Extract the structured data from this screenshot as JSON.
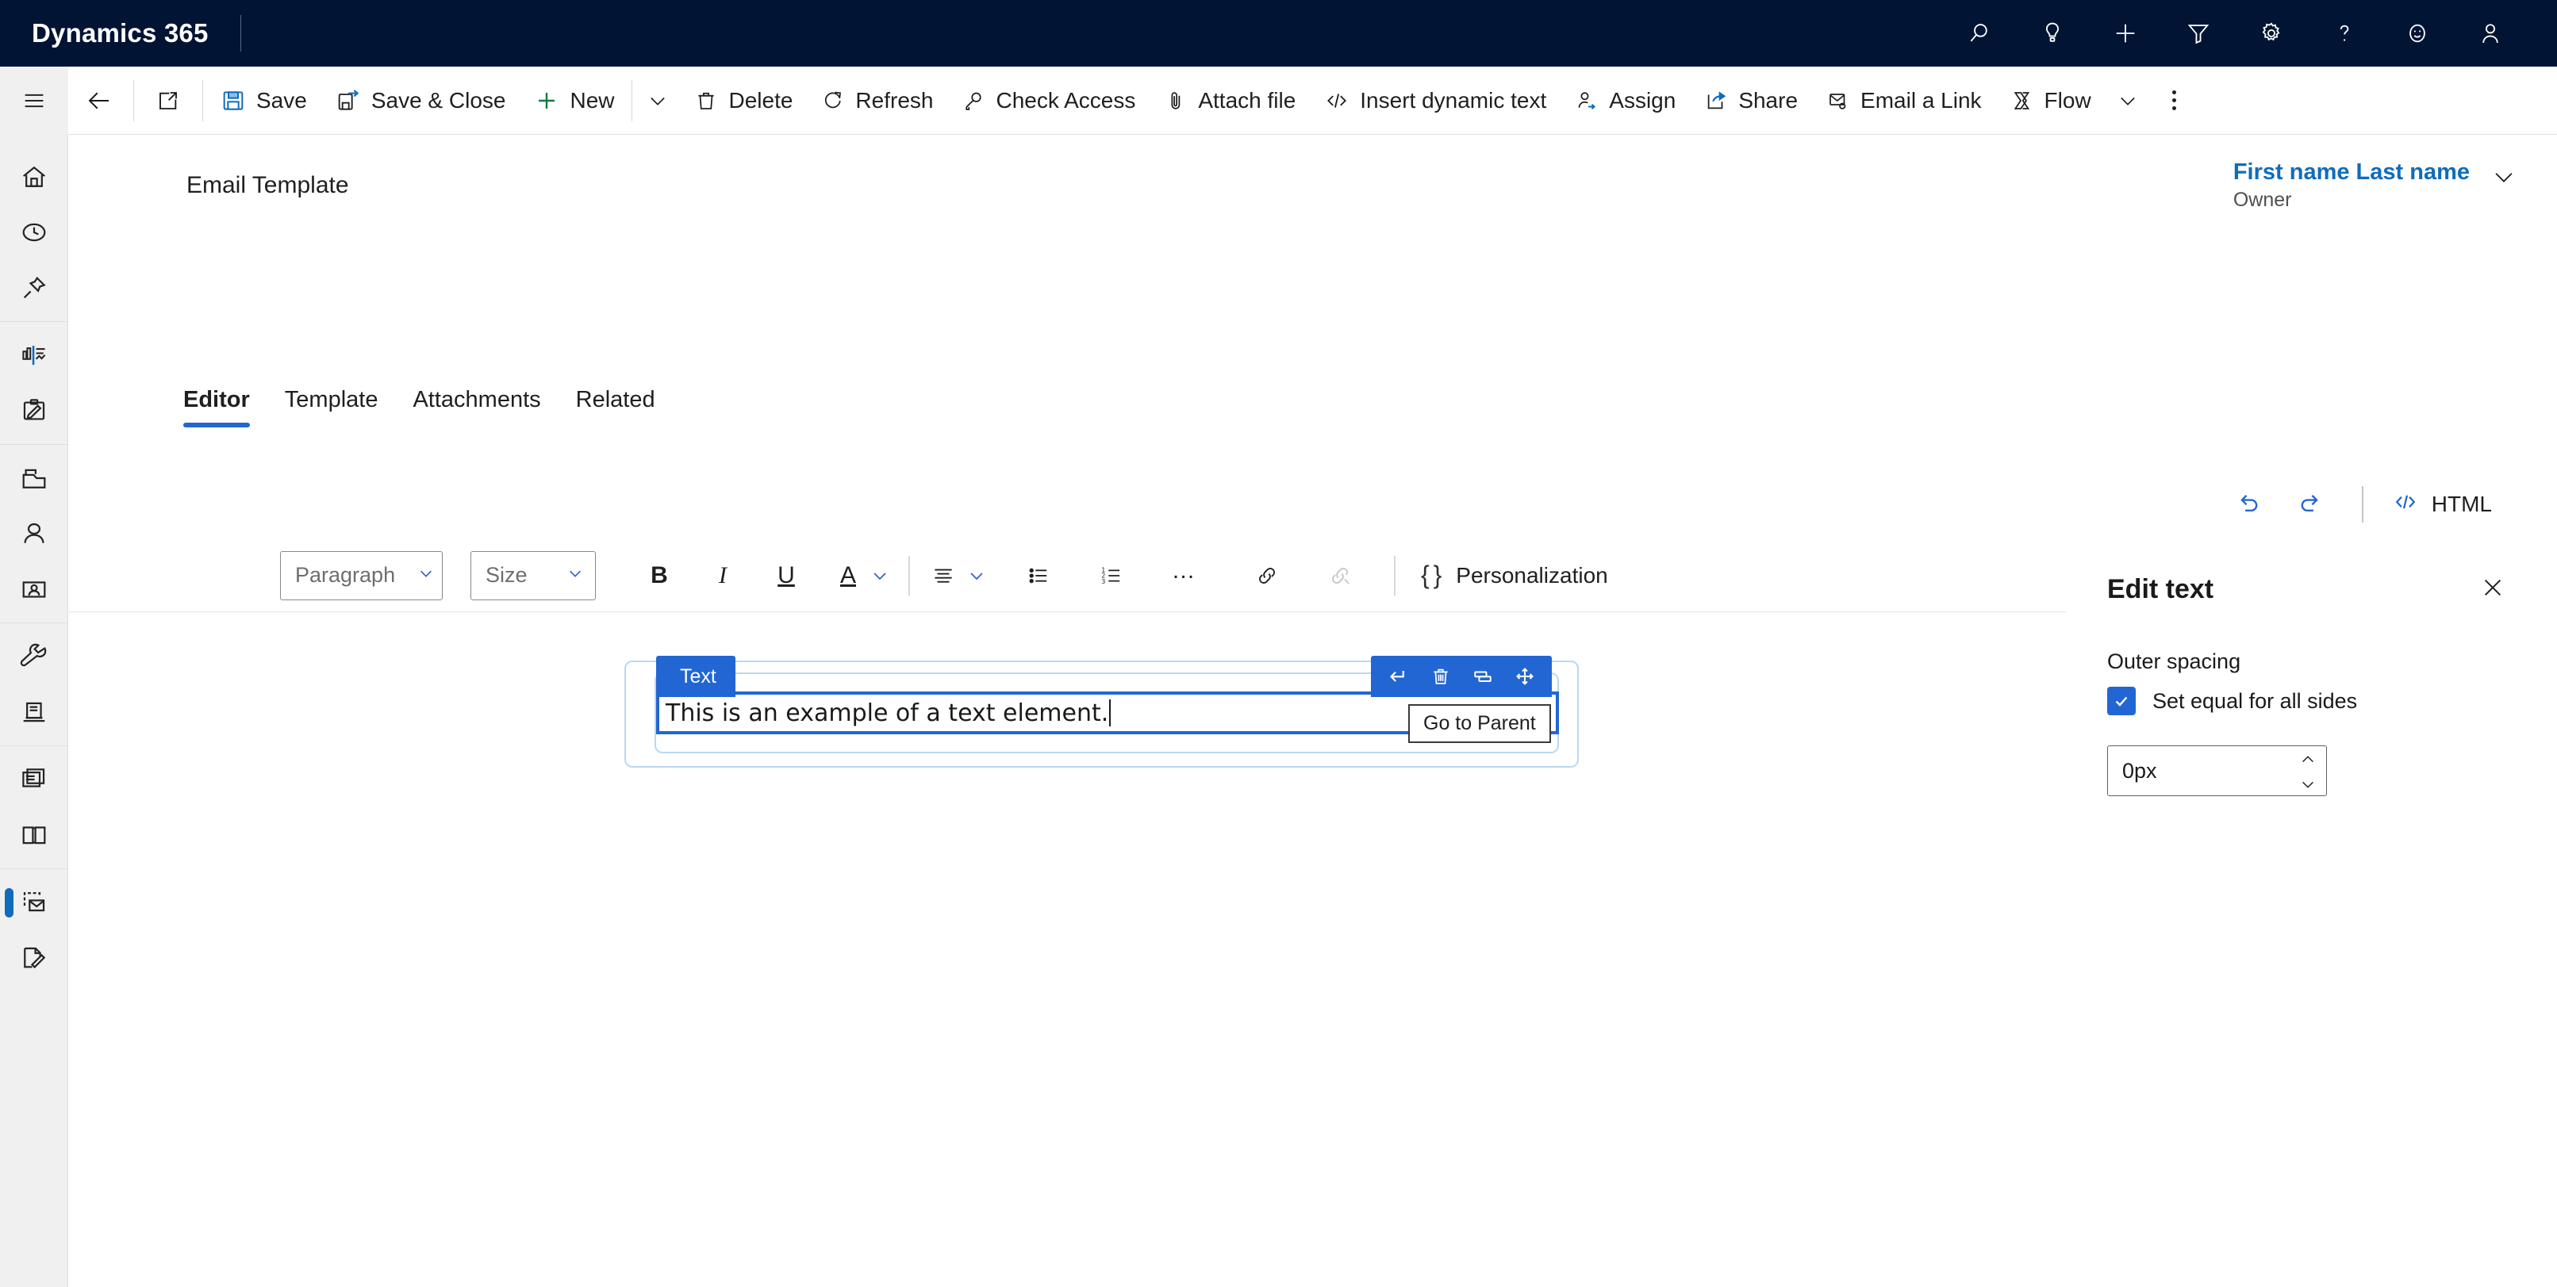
{
  "topbar": {
    "brand": "Dynamics 365",
    "icons": [
      {
        "name": "search-icon",
        "label": "Search"
      },
      {
        "name": "lightbulb-icon",
        "label": "Insights"
      },
      {
        "name": "plus-icon",
        "label": "Quick create"
      },
      {
        "name": "filter-icon",
        "label": "Filter"
      },
      {
        "name": "gear-icon",
        "label": "Settings"
      },
      {
        "name": "question-icon",
        "label": "Help"
      },
      {
        "name": "smiley-icon",
        "label": "Feedback"
      },
      {
        "name": "user-avatar-icon",
        "label": "Account"
      }
    ]
  },
  "commandbar": {
    "back_label": "Back",
    "popout_label": "Open in new window",
    "items": [
      {
        "name": "save-button",
        "label": "Save",
        "icon": "save-icon"
      },
      {
        "name": "save-and-close-button",
        "label": "Save & Close",
        "icon": "save-close-icon"
      },
      {
        "name": "new-button",
        "label": "New",
        "icon": "plus-icon"
      },
      {
        "name": "delete-button",
        "label": "Delete",
        "icon": "trash-icon"
      },
      {
        "name": "refresh-button",
        "label": "Refresh",
        "icon": "refresh-icon"
      },
      {
        "name": "check-access-button",
        "label": "Check Access",
        "icon": "key-icon"
      },
      {
        "name": "attach-file-button",
        "label": "Attach file",
        "icon": "paperclip-icon"
      },
      {
        "name": "insert-dynamic-text-button",
        "label": "Insert dynamic text",
        "icon": "code-icon"
      },
      {
        "name": "assign-button",
        "label": "Assign",
        "icon": "person-arrow-icon"
      },
      {
        "name": "share-button",
        "label": "Share",
        "icon": "share-icon"
      },
      {
        "name": "email-a-link-button",
        "label": "Email a Link",
        "icon": "envelope-link-icon"
      },
      {
        "name": "flow-button",
        "label": "Flow",
        "icon": "flow-icon"
      }
    ]
  },
  "rail": {
    "items": [
      {
        "name": "sitemap-hamburger",
        "icon": "hamburger-icon",
        "active": false
      },
      {
        "name": "rail-item-home",
        "icon": "home-icon",
        "active": false
      },
      {
        "name": "rail-item-recent",
        "icon": "clock-icon",
        "active": false
      },
      {
        "name": "rail-item-pinned",
        "icon": "pin-icon",
        "active": false
      },
      {
        "name": "rail-item-dashboards",
        "icon": "chart-icon",
        "active": false
      },
      {
        "name": "rail-item-activities",
        "icon": "clipboard-edit-icon",
        "active": false
      },
      {
        "name": "rail-item-accounts",
        "icon": "folder-icon",
        "active": false
      },
      {
        "name": "rail-item-contacts",
        "icon": "person-icon",
        "active": false
      },
      {
        "name": "rail-item-leads",
        "icon": "contact-card-icon",
        "active": false
      },
      {
        "name": "rail-item-cases",
        "icon": "wrench-icon",
        "active": false
      },
      {
        "name": "rail-item-knowledge",
        "icon": "document-icon",
        "active": false
      },
      {
        "name": "rail-item-articles",
        "icon": "documents-stack-icon",
        "active": false
      },
      {
        "name": "rail-item-library",
        "icon": "book-icon",
        "active": false
      },
      {
        "name": "rail-item-email-templates",
        "icon": "email-template-icon",
        "active": true
      },
      {
        "name": "rail-item-document-templates",
        "icon": "document-edit-icon",
        "active": false
      }
    ]
  },
  "page": {
    "title": "Email Template",
    "owner": {
      "name": "First name Last name",
      "role": "Owner"
    },
    "tabs": [
      {
        "name": "tab-editor",
        "label": "Editor",
        "active": true
      },
      {
        "name": "tab-template",
        "label": "Template",
        "active": false
      },
      {
        "name": "tab-attachments",
        "label": "Attachments",
        "active": false
      },
      {
        "name": "tab-related",
        "label": "Related",
        "active": false
      }
    ]
  },
  "editor": {
    "undo_label": "Undo",
    "redo_label": "Redo",
    "html_label": "HTML",
    "toolbar": {
      "paragraph_placeholder": "Paragraph",
      "size_placeholder": "Size",
      "bold_label": "B",
      "italic_label": "I",
      "underline_label": "U",
      "font_color_label": "A",
      "more_label": "…",
      "personalization_label": "Personalization",
      "brace_glyph": "{ }"
    },
    "element": {
      "tag_label": "Text",
      "content": "This is an example of a text element.",
      "actions": [
        {
          "name": "go-to-parent-button",
          "icon": "go-to-parent-icon"
        },
        {
          "name": "delete-element-button",
          "icon": "trash-icon"
        },
        {
          "name": "duplicate-element-button",
          "icon": "duplicate-icon"
        },
        {
          "name": "move-element-button",
          "icon": "move-icon"
        }
      ],
      "tooltip": "Go to Parent"
    }
  },
  "side_panel": {
    "title": "Edit text",
    "close_label": "Close",
    "outer_spacing_label": "Outer spacing",
    "set_equal_label": "Set equal for all sides",
    "spacing_value": "0px"
  },
  "colors": {
    "header_bg": "#011434",
    "accent_blue": "#2266d3",
    "link_blue": "#0f6cbd",
    "rail_bg": "#f0f0f0",
    "element_outline": "#bcd7f0"
  }
}
